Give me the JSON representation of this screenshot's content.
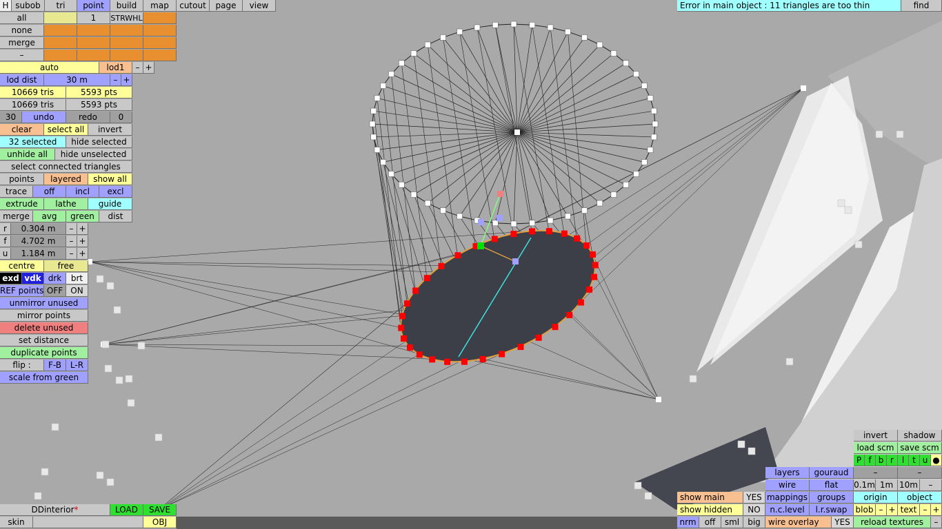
{
  "top_menu": [
    "H",
    "subob",
    "tri",
    "point",
    "build",
    "map",
    "cutout",
    "page",
    "view"
  ],
  "status": {
    "message": "Error in main object : 11 triangles are too thin",
    "find": "find"
  },
  "selector": {
    "all": "all",
    "none": "none",
    "merge": "merge",
    "dash": "–",
    "count": "1",
    "flags": "STRWHL"
  },
  "lod": {
    "auto": "auto",
    "level": "lod1",
    "minus": "–",
    "plus": "+",
    "dist_label": "lod dist",
    "dist_value": "30 m"
  },
  "stats": {
    "tris1": "10669 tris",
    "pts1": "5593 pts",
    "tris2": "10669 tris",
    "pts2": "5593 pts"
  },
  "undo": {
    "count": "30",
    "undo": "undo",
    "redo": "redo",
    "redo_count": "0"
  },
  "select": {
    "clear": "clear",
    "select_all": "select all",
    "invert": "invert",
    "selected": "32 selected",
    "hide_selected": "hide selected",
    "unhide_all": "unhide all",
    "hide_unselected": "hide unselected",
    "select_connected": "select connected triangles"
  },
  "points_mode": {
    "points": "points",
    "layered": "layered",
    "show_all": "show all"
  },
  "trace": {
    "trace": "trace",
    "off": "off",
    "incl": "incl",
    "excl": "excl"
  },
  "tools": {
    "extrude": "extrude",
    "lathe": "lathe",
    "guide": "guide",
    "merge": "merge",
    "avg": "avg",
    "green": "green",
    "dist": "dist"
  },
  "rfu": [
    {
      "label": "r",
      "value": "0.304 m"
    },
    {
      "label": "f",
      "value": "4.702 m"
    },
    {
      "label": "u",
      "value": "1.184 m"
    }
  ],
  "centre": {
    "centre": "centre",
    "free": "free"
  },
  "palette": {
    "exd": "exd",
    "vdk": "vdk",
    "drk": "drk",
    "brt": "brt"
  },
  "ref": {
    "label": "REF points",
    "off": "OFF",
    "on": "ON"
  },
  "ops": {
    "unmirror": "unmirror unused",
    "mirror": "mirror points",
    "delete": "delete unused",
    "set_distance": "set distance",
    "duplicate": "duplicate points",
    "flip": "flip :",
    "fb": "F-B",
    "lr": "L-R",
    "scale": "scale from green"
  },
  "file": {
    "name": "DDinterior",
    "modified": "*",
    "load": "LOAD",
    "save": "SAVE",
    "skin": "skin",
    "obj": "OBJ"
  },
  "view_panel": {
    "invert": "invert",
    "shadow": "shadow",
    "load_scm": "load scm",
    "save_scm": "save scm",
    "pflags": [
      "P",
      "f",
      "b",
      "r",
      "l",
      "t",
      "u",
      "●"
    ],
    "layers": "layers",
    "gouraud": "gouraud",
    "dash": "–",
    "wire": "wire",
    "flat": "flat",
    "grid": [
      "0.1m",
      "1m",
      "10m"
    ],
    "show_main": "show main",
    "yes": "YES",
    "mappings": "mappings",
    "groups": "groups",
    "origin": "origin",
    "object": "object",
    "show_hidden": "show hidden",
    "no": "NO",
    "nc_level": "n.c.level",
    "lr_swap": "l.r.swap",
    "blob": "blob",
    "text": "text",
    "minus": "–",
    "plus": "+",
    "nrm": "nrm",
    "off": "off",
    "sml": "sml",
    "big": "big",
    "wire_overlay": "wire overlay",
    "wire_yes": "YES",
    "reload_textures": "reload textures"
  },
  "colors": {
    "viewport": "#a9a9a9",
    "selected_point": "#ff0000",
    "green_point": "#00e000",
    "hole_fill": "#3c3e48",
    "highlight_line": "#40e0e0"
  }
}
